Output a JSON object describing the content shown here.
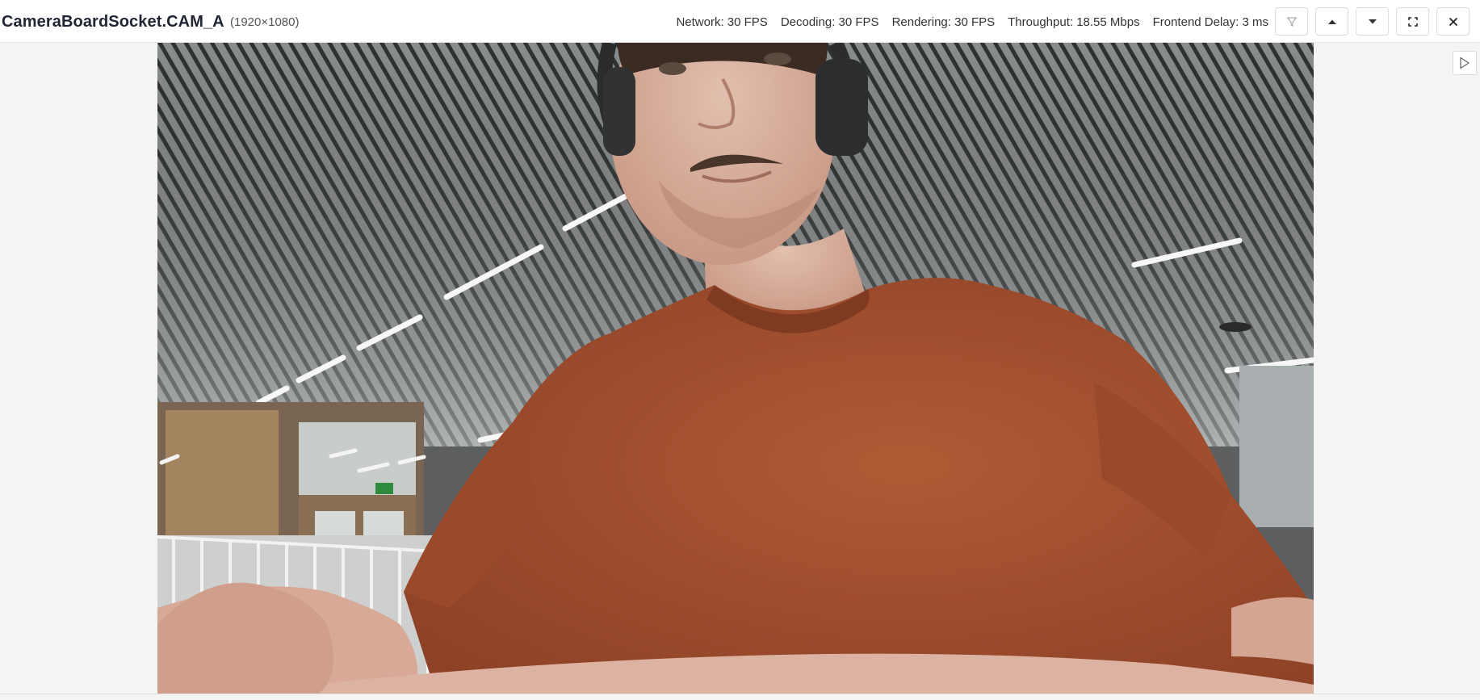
{
  "header": {
    "title": "CameraBoardSocket.CAM_A",
    "resolution": "(1920×1080)",
    "stats": {
      "network": "Network: 30 FPS",
      "decoding": "Decoding: 30 FPS",
      "rendering": "Rendering: 30 FPS",
      "throughput": "Throughput: 18.55 Mbps",
      "frontend_delay": "Frontend Delay: 3 ms"
    },
    "buttons": {
      "filter": "filter-icon",
      "up": "caret-up-icon",
      "down": "caret-down-icon",
      "fullscreen": "fullscreen-icon",
      "close": "close-icon"
    }
  },
  "stream": {
    "scene": "camera-feed",
    "shirt_color": "#a9522f",
    "ceiling_color": "#6c6f70"
  },
  "sidebar": {
    "toggle_icon": "play-outline-icon"
  }
}
